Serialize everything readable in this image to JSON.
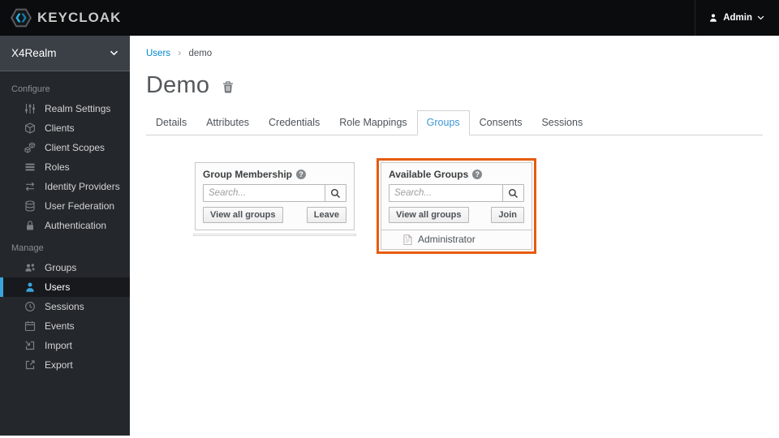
{
  "header": {
    "brand": "KEYCLOAK",
    "user_label": "Admin"
  },
  "sidebar": {
    "realm": "X4Realm",
    "sections": [
      {
        "label": "Configure",
        "items": [
          {
            "label": "Realm Settings",
            "icon": "sliders-icon"
          },
          {
            "label": "Clients",
            "icon": "cube-icon"
          },
          {
            "label": "Client Scopes",
            "icon": "cubes-icon"
          },
          {
            "label": "Roles",
            "icon": "list-icon"
          },
          {
            "label": "Identity Providers",
            "icon": "exchange-icon"
          },
          {
            "label": "User Federation",
            "icon": "database-icon"
          },
          {
            "label": "Authentication",
            "icon": "lock-icon"
          }
        ]
      },
      {
        "label": "Manage",
        "items": [
          {
            "label": "Groups",
            "icon": "users-group-icon"
          },
          {
            "label": "Users",
            "icon": "user-icon",
            "active": true
          },
          {
            "label": "Sessions",
            "icon": "clock-icon"
          },
          {
            "label": "Events",
            "icon": "calendar-icon"
          },
          {
            "label": "Import",
            "icon": "import-icon"
          },
          {
            "label": "Export",
            "icon": "export-icon"
          }
        ]
      }
    ]
  },
  "breadcrumb": {
    "link": "Users",
    "separator": "›",
    "current": "demo"
  },
  "page": {
    "title": "Demo"
  },
  "tabs": [
    {
      "label": "Details"
    },
    {
      "label": "Attributes"
    },
    {
      "label": "Credentials"
    },
    {
      "label": "Role Mappings"
    },
    {
      "label": "Groups",
      "active": true
    },
    {
      "label": "Consents"
    },
    {
      "label": "Sessions"
    }
  ],
  "panels": {
    "group_membership": {
      "title": "Group Membership",
      "help_glyph": "?",
      "search_placeholder": "Search...",
      "view_all_label": "View all groups",
      "action_label": "Leave"
    },
    "available_groups": {
      "title": "Available Groups",
      "help_glyph": "?",
      "search_placeholder": "Search...",
      "view_all_label": "View all groups",
      "action_label": "Join",
      "groups": [
        {
          "name": "Administrator"
        }
      ]
    }
  },
  "colors": {
    "accent_blue": "#0088ce",
    "nav_active_blue": "#39a5dc",
    "highlight_orange": "#e65b0e"
  }
}
